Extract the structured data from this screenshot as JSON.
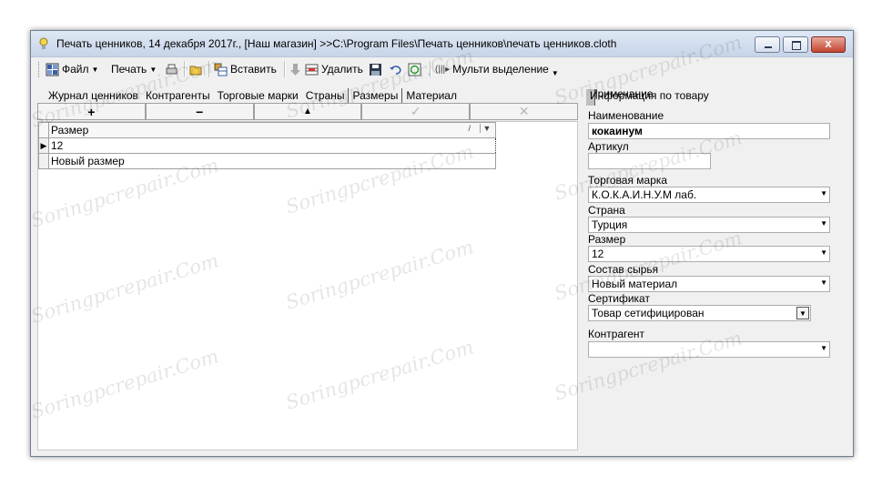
{
  "window": {
    "title": "Печать ценников, 14 декабря 2017г., [Наш магазин] >>C:\\Program Files\\Печать ценников\\печать ценников.cloth",
    "close_glyph": "x"
  },
  "toolbar": {
    "file_label": "Файл",
    "print_label": "Печать",
    "paste_label": "Вставить",
    "delete_label": "Удалить",
    "multi_select_label": "Мульти выделение",
    "dropdown_glyph": "▼",
    "multi_select_prefix": "(|||▸"
  },
  "tabs": [
    "Журнал ценников",
    "Контрагенты",
    "Торговые марки",
    "Страны",
    "Размеры",
    "Материал"
  ],
  "active_tab_index": 4,
  "navigator": {
    "add": "+",
    "remove": "−",
    "up": "▲",
    "confirm": "✓",
    "cancel": "✕"
  },
  "grid": {
    "column_header": "Размер",
    "header_slash": "/",
    "header_dropdown": "▼",
    "current_row_marker": "▶",
    "rows": [
      "12",
      "Новый размер"
    ]
  },
  "right_panel": {
    "tabs": [
      "Информация по товару",
      "Примечание"
    ],
    "fields": {
      "name_label": "Наименование",
      "name_value": "кокаинум",
      "article_label": "Артикул",
      "article_value": "",
      "brand_label": "Торговая марка",
      "brand_value": "К.О.К.А.И.Н.У.М лаб.",
      "country_label": "Страна",
      "country_value": "Турция",
      "size_label": "Размер",
      "size_value": "12",
      "material_label": "Состав сырья",
      "material_value": "Новый материал",
      "cert_label": "Сертификат",
      "cert_value": "Товар сетифицирован",
      "contractor_label": "Контрагент",
      "contractor_value": ""
    },
    "combo_arrow": "▼"
  },
  "watermark": "Soringpcrepair.Com"
}
